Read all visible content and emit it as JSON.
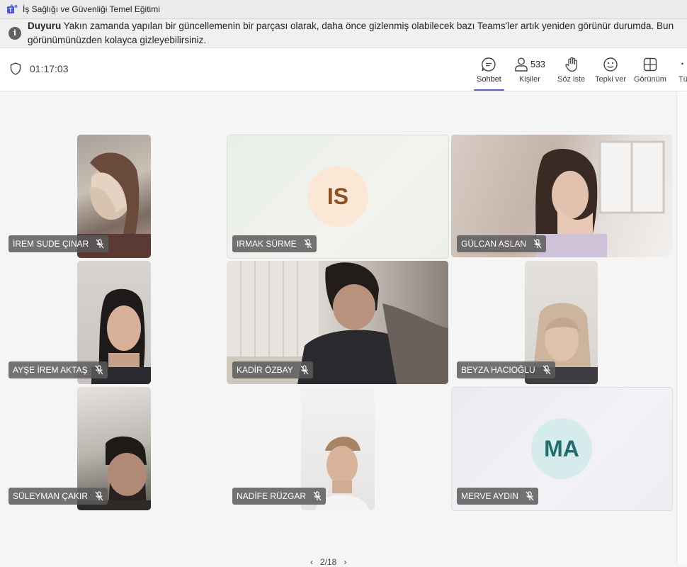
{
  "window": {
    "title": "İş Sağlığı ve Güvenliği Temel Eğitimi"
  },
  "banner": {
    "label": "Duyuru",
    "line1": "Yakın zamanda yapılan bir güncellemenin bir parçası olarak, daha önce gizlenmiş olabilecek bazı Teams'ler artık yeniden görünür durumda. Bun",
    "line2": "görünümünüzden kolayca gizleyebilirsiniz."
  },
  "toolbar": {
    "timer": "01:17:03",
    "chat_label": "Sohbet",
    "people_label": "Kişiler",
    "people_count": "533",
    "raise_label": "Söz iste",
    "react_label": "Tepki ver",
    "view_label": "Görünüm",
    "more_label": "Tü"
  },
  "participants": [
    {
      "name": "İREM SUDE ÇINAR",
      "type": "video"
    },
    {
      "name": "IRMAK SÜRME",
      "type": "avatar",
      "initials": "IS"
    },
    {
      "name": "GÜLCAN ASLAN",
      "type": "video"
    },
    {
      "name": "AYŞE İREM AKTAŞ",
      "type": "video"
    },
    {
      "name": "KADİR ÖZBAY",
      "type": "video"
    },
    {
      "name": "BEYZA HACIOĞLU",
      "type": "video"
    },
    {
      "name": "SÜLEYMAN ÇAKIR",
      "type": "video"
    },
    {
      "name": "NADİFE RÜZGAR",
      "type": "video"
    },
    {
      "name": "MERVE AYDIN",
      "type": "avatar",
      "initials": "MA"
    }
  ],
  "pager": {
    "text": "2/18"
  },
  "colors": {
    "accent": "#5b5fc7",
    "is_avatar_bg": "#fbe7d6",
    "is_avatar_fg": "#8a5224",
    "ma_avatar_bg": "#d6ecec",
    "ma_avatar_fg": "#1f6d6d"
  }
}
